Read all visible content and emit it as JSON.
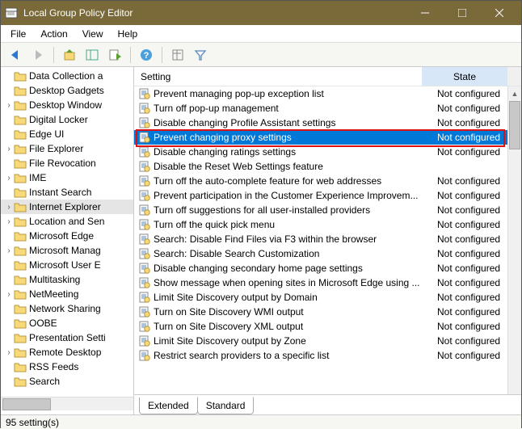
{
  "window": {
    "title": "Local Group Policy Editor"
  },
  "menu": {
    "file": "File",
    "action": "Action",
    "view": "View",
    "help": "Help"
  },
  "header": {
    "setting": "Setting",
    "state": "State"
  },
  "tree": {
    "items": [
      {
        "label": "Data Collection a",
        "exp": ""
      },
      {
        "label": "Desktop Gadgets",
        "exp": ""
      },
      {
        "label": "Desktop Window",
        "exp": "›"
      },
      {
        "label": "Digital Locker",
        "exp": ""
      },
      {
        "label": "Edge UI",
        "exp": ""
      },
      {
        "label": "File Explorer",
        "exp": "›"
      },
      {
        "label": "File Revocation",
        "exp": ""
      },
      {
        "label": "IME",
        "exp": "›"
      },
      {
        "label": "Instant Search",
        "exp": ""
      },
      {
        "label": "Internet Explorer",
        "exp": "›",
        "sel": true
      },
      {
        "label": "Location and Sen",
        "exp": "›"
      },
      {
        "label": "Microsoft Edge",
        "exp": ""
      },
      {
        "label": "Microsoft Manag",
        "exp": "›"
      },
      {
        "label": "Microsoft User E",
        "exp": ""
      },
      {
        "label": "Multitasking",
        "exp": ""
      },
      {
        "label": "NetMeeting",
        "exp": "›"
      },
      {
        "label": "Network Sharing",
        "exp": ""
      },
      {
        "label": "OOBE",
        "exp": ""
      },
      {
        "label": "Presentation Setti",
        "exp": ""
      },
      {
        "label": "Remote Desktop",
        "exp": "›"
      },
      {
        "label": "RSS Feeds",
        "exp": ""
      },
      {
        "label": "Search",
        "exp": ""
      }
    ]
  },
  "settings": {
    "items": [
      {
        "label": "Prevent managing pop-up exception list",
        "state": "Not configured"
      },
      {
        "label": "Turn off pop-up management",
        "state": "Not configured"
      },
      {
        "label": "Disable changing Profile Assistant settings",
        "state": "Not configured"
      },
      {
        "label": "Prevent changing proxy settings",
        "state": "Not configured",
        "sel": true
      },
      {
        "label": "Disable changing ratings settings",
        "state": "Not configured"
      },
      {
        "label": "Disable the Reset Web Settings feature",
        "state": ""
      },
      {
        "label": "Turn off the auto-complete feature for web addresses",
        "state": "Not configured"
      },
      {
        "label": "Prevent participation in the Customer Experience Improvem...",
        "state": "Not configured"
      },
      {
        "label": "Turn off suggestions for all user-installed providers",
        "state": "Not configured"
      },
      {
        "label": "Turn off the quick pick menu",
        "state": "Not configured"
      },
      {
        "label": "Search: Disable Find Files via F3 within the browser",
        "state": "Not configured"
      },
      {
        "label": "Search: Disable Search Customization",
        "state": "Not configured"
      },
      {
        "label": "Disable changing secondary home page settings",
        "state": "Not configured"
      },
      {
        "label": "Show message when opening sites in Microsoft Edge using ...",
        "state": "Not configured"
      },
      {
        "label": "Limit Site Discovery output by Domain",
        "state": "Not configured"
      },
      {
        "label": "Turn on Site Discovery WMI output",
        "state": "Not configured"
      },
      {
        "label": "Turn on Site Discovery XML output",
        "state": "Not configured"
      },
      {
        "label": "Limit Site Discovery output by Zone",
        "state": "Not configured"
      },
      {
        "label": "Restrict search providers to a specific list",
        "state": "Not configured"
      }
    ]
  },
  "tabs": {
    "extended": "Extended",
    "standard": "Standard"
  },
  "status": {
    "text": "95 setting(s)"
  }
}
